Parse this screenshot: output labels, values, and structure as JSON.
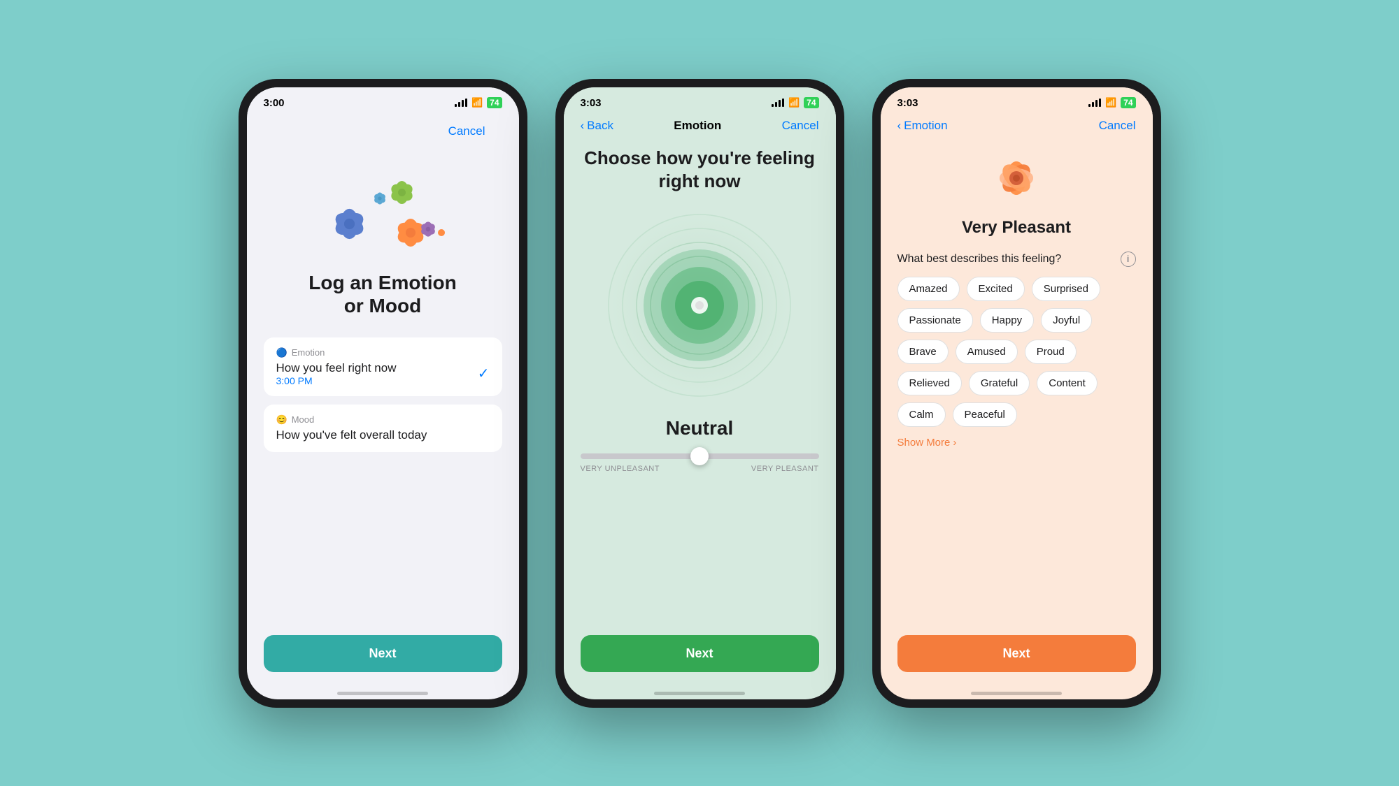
{
  "background_color": "#7ececa",
  "phones": [
    {
      "id": "phone1",
      "screen_bg": "#f2f2f7",
      "status": {
        "time": "3:00",
        "location": true,
        "battery": "74"
      },
      "nav": {
        "back": null,
        "title": null,
        "cancel": "Cancel"
      },
      "content": {
        "title": "Log an Emotion\nor Mood",
        "options": [
          {
            "icon": "🔵",
            "label": "Emotion",
            "description": "How you feel right now",
            "time": "3:00 PM",
            "checked": true
          },
          {
            "icon": "😊",
            "label": "Mood",
            "description": "How you've felt overall today",
            "time": null,
            "checked": false
          }
        ],
        "next_label": "Next",
        "next_color": "#32aba5"
      }
    },
    {
      "id": "phone2",
      "screen_bg": "#d6eadf",
      "status": {
        "time": "3:03",
        "location": true,
        "battery": "74"
      },
      "nav": {
        "back": "Back",
        "title": "Emotion",
        "cancel": "Cancel"
      },
      "content": {
        "title": "Choose how you're feeling\nright now",
        "emotion_label": "Neutral",
        "slider_left": "VERY UNPLEASANT",
        "slider_right": "VERY PLEASANT",
        "next_label": "Next",
        "next_color": "#34a853"
      }
    },
    {
      "id": "phone3",
      "screen_bg": "#fde8da",
      "status": {
        "time": "3:03",
        "location": true,
        "battery": "74"
      },
      "nav": {
        "back": "Emotion",
        "title": null,
        "cancel": "Cancel"
      },
      "content": {
        "emotion_state": "Very Pleasant",
        "question": "What best describes this feeling?",
        "tags": [
          "Amazed",
          "Excited",
          "Surprised",
          "Passionate",
          "Happy",
          "Joyful",
          "Brave",
          "Amused",
          "Proud",
          "Relieved",
          "Grateful",
          "Content",
          "Calm",
          "Peaceful"
        ],
        "show_more": "Show More",
        "next_label": "Next",
        "next_color": "#f47c3c"
      }
    }
  ]
}
